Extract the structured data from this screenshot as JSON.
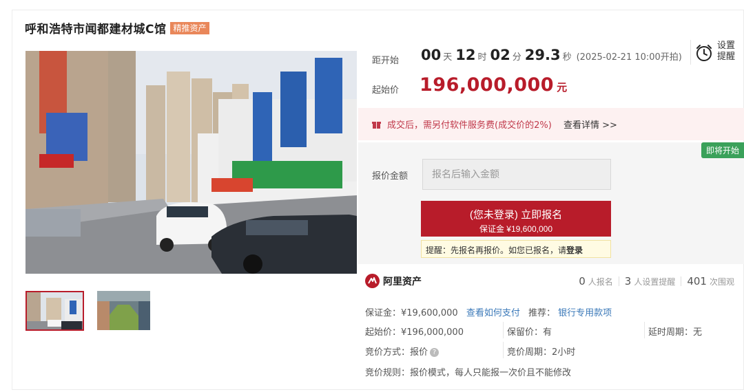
{
  "header": {
    "title": "呼和浩特市闻都建材城C馆",
    "tag": "精推资产"
  },
  "gallery": {
    "thumbnails": [
      "photo-1",
      "photo-2"
    ],
    "active_index": 0
  },
  "countdown": {
    "label": "距开始",
    "days": "00",
    "days_unit": "天",
    "hours": "12",
    "hours_unit": "时",
    "minutes": "02",
    "minutes_unit": "分",
    "seconds": "29.3",
    "seconds_unit": "秒",
    "start_time": "(2025-02-21 10:00开拍)"
  },
  "reminder": {
    "line1": "设置",
    "line2": "提醒",
    "icon": "alarm-clock-icon"
  },
  "starting_price": {
    "label": "起始价",
    "value": "196,000,000",
    "unit": "元"
  },
  "fee_notice": {
    "text": "成交后，需另付软件服务费(成交价的2%)",
    "link": "查看详情 >>"
  },
  "bid": {
    "status_badge": "即将开始",
    "amount_label": "报价金额",
    "input_placeholder": "报名后输入金额",
    "signup_line1": "(您未登录) 立即报名",
    "signup_line2": "保证金 ¥19,600,000",
    "hint_prefix": "提醒：先报名再报价。如您已报名，请",
    "hint_login": "登录"
  },
  "platform": {
    "name": "阿里资产"
  },
  "stats": {
    "registrants": "0",
    "registrants_label": "人报名",
    "reminders": "3",
    "reminders_label": "人设置提醒",
    "views": "401",
    "views_label": "次围观"
  },
  "details": {
    "deposit": "保证金：¥19,600,000",
    "deposit_link": "查看如何支付",
    "recommend_label": "推荐：",
    "recommend_link": "银行专用款项",
    "start_price": "起始价：¥196,000,000",
    "reserve_price": "保留价：有",
    "delay_period": "延时周期：无",
    "bid_method": "竞价方式：报价",
    "bid_period": "竞价周期：2小时",
    "bid_rule": "竞价规则：报价模式，每人只能报一次价且不能修改"
  },
  "colors": {
    "accent": "#b81c2a",
    "tag": "#e9875a",
    "badge": "#3aa15a",
    "link": "#3a78b8"
  }
}
